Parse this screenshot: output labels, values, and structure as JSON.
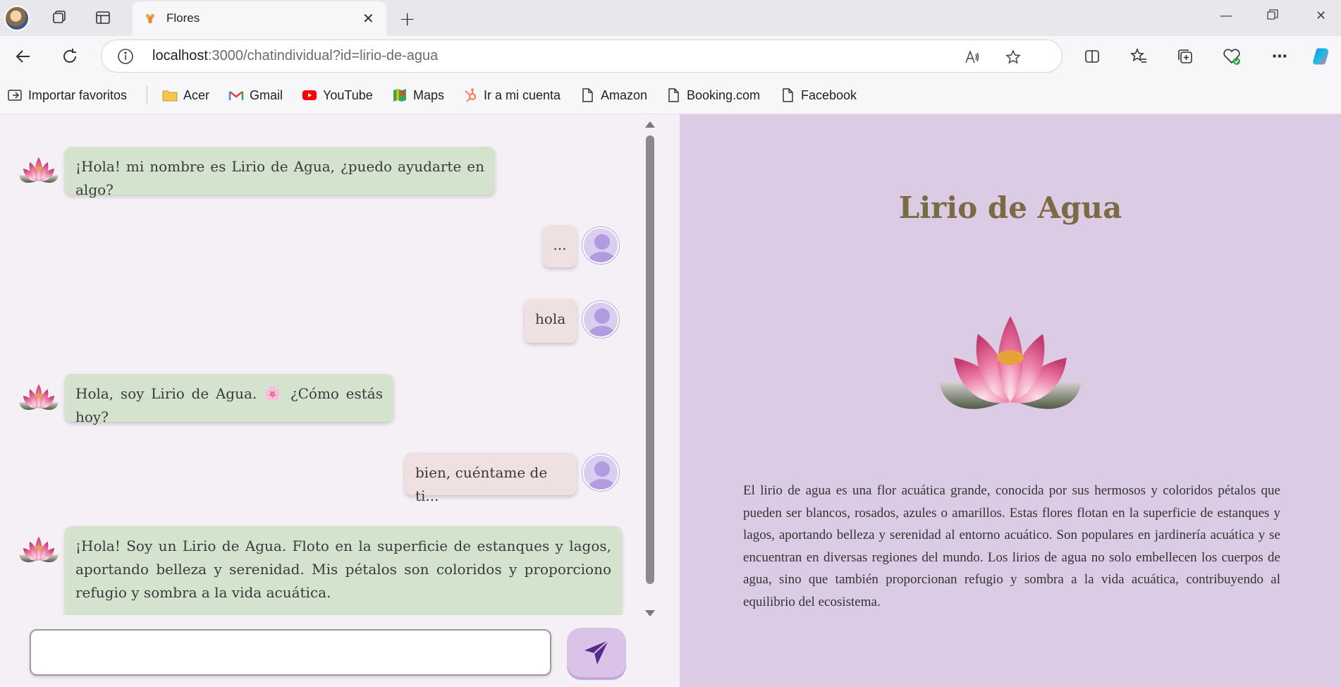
{
  "browser": {
    "tab_title": "Flores",
    "url_host": "localhost",
    "url_rest": ":3000/chatindividual?id=lirio-de-agua",
    "bookmarks": [
      {
        "label": "Importar favoritos",
        "icon": "import-icon"
      },
      {
        "label": "Acer",
        "icon": "folder-icon"
      },
      {
        "label": "Gmail",
        "icon": "gmail-icon"
      },
      {
        "label": "YouTube",
        "icon": "youtube-icon"
      },
      {
        "label": "Maps",
        "icon": "maps-icon"
      },
      {
        "label": "Ir a mi cuenta",
        "icon": "hubspot-icon"
      },
      {
        "label": "Amazon",
        "icon": "page-icon"
      },
      {
        "label": "Booking.com",
        "icon": "page-icon"
      },
      {
        "label": "Facebook",
        "icon": "page-icon"
      }
    ]
  },
  "chat": {
    "messages": [
      {
        "sender": "bot",
        "text": "¡Hola! mi nombre es Lirio de Agua, ¿puedo ayudarte en algo?"
      },
      {
        "sender": "user",
        "text": "..."
      },
      {
        "sender": "user",
        "text": "hola"
      },
      {
        "sender": "bot",
        "text": "Hola, soy Lirio de Agua. 🌸 ¿Cómo estás hoy?"
      },
      {
        "sender": "user",
        "text": "bien, cuéntame de ti..."
      },
      {
        "sender": "bot",
        "text": "¡Hola! Soy un Lirio de Agua. Floto en la superficie de estanques y lagos, aportando belleza y serenidad. Mis pétalos son coloridos y proporciono refugio y sombra a la vida acuática."
      }
    ],
    "input_value": ""
  },
  "info": {
    "title": "Lirio de Agua",
    "description": "El lirio de agua es una flor acuática grande, conocida por sus hermosos y coloridos pétalos que pueden ser blancos, rosados, azules o amarillos. Estas flores flotan en la superficie de estanques y lagos, aportando belleza y serenidad al entorno acuático. Son populares en jardinería acuática y se encuentran en diversas regiones del mundo. Los lirios de agua no solo embellecen los cuerpos de agua, sino que también proporcionan refugio y sombra a la vida acuática, contribuyendo al equilibrio del ecosistema."
  },
  "colors": {
    "chat_background": "#f5f0f6",
    "info_background": "#dccbe5",
    "bot_bubble": "#d4e3cd",
    "user_bubble": "#efe1e2",
    "title_color": "#7b6b44",
    "send_button": "#d9c4e8"
  }
}
